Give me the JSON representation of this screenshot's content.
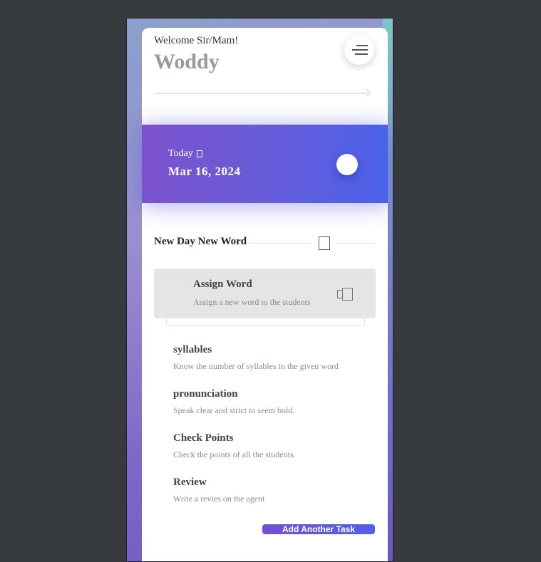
{
  "header": {
    "welcome": "Welcome Sir/Mam!",
    "username": "Woddy",
    "menu_icon": "hamburger-menu-icon"
  },
  "today": {
    "label": "Today",
    "date": "Mar 16, 2024"
  },
  "section": {
    "title": "New Day New Word",
    "icon": "bookmark-icon"
  },
  "assign": {
    "title": "Assign Word",
    "subtitle": "Assign a new word to the students",
    "icon": "copy-icon"
  },
  "tasks": [
    {
      "title": "syllables",
      "desc": "Know the number of syllables in the given word"
    },
    {
      "title": "pronunciation",
      "desc": "Speak clear and strict to seem bold."
    },
    {
      "title": "Check Points",
      "desc": "Check the points of all the students."
    },
    {
      "title": "Review",
      "desc": "Write a revies on the agent"
    }
  ],
  "add_button": "Add Another Task",
  "colors": {
    "banner_start": "#7b52cf",
    "banner_end": "#4a62ea",
    "username": "#9a9a9a"
  }
}
